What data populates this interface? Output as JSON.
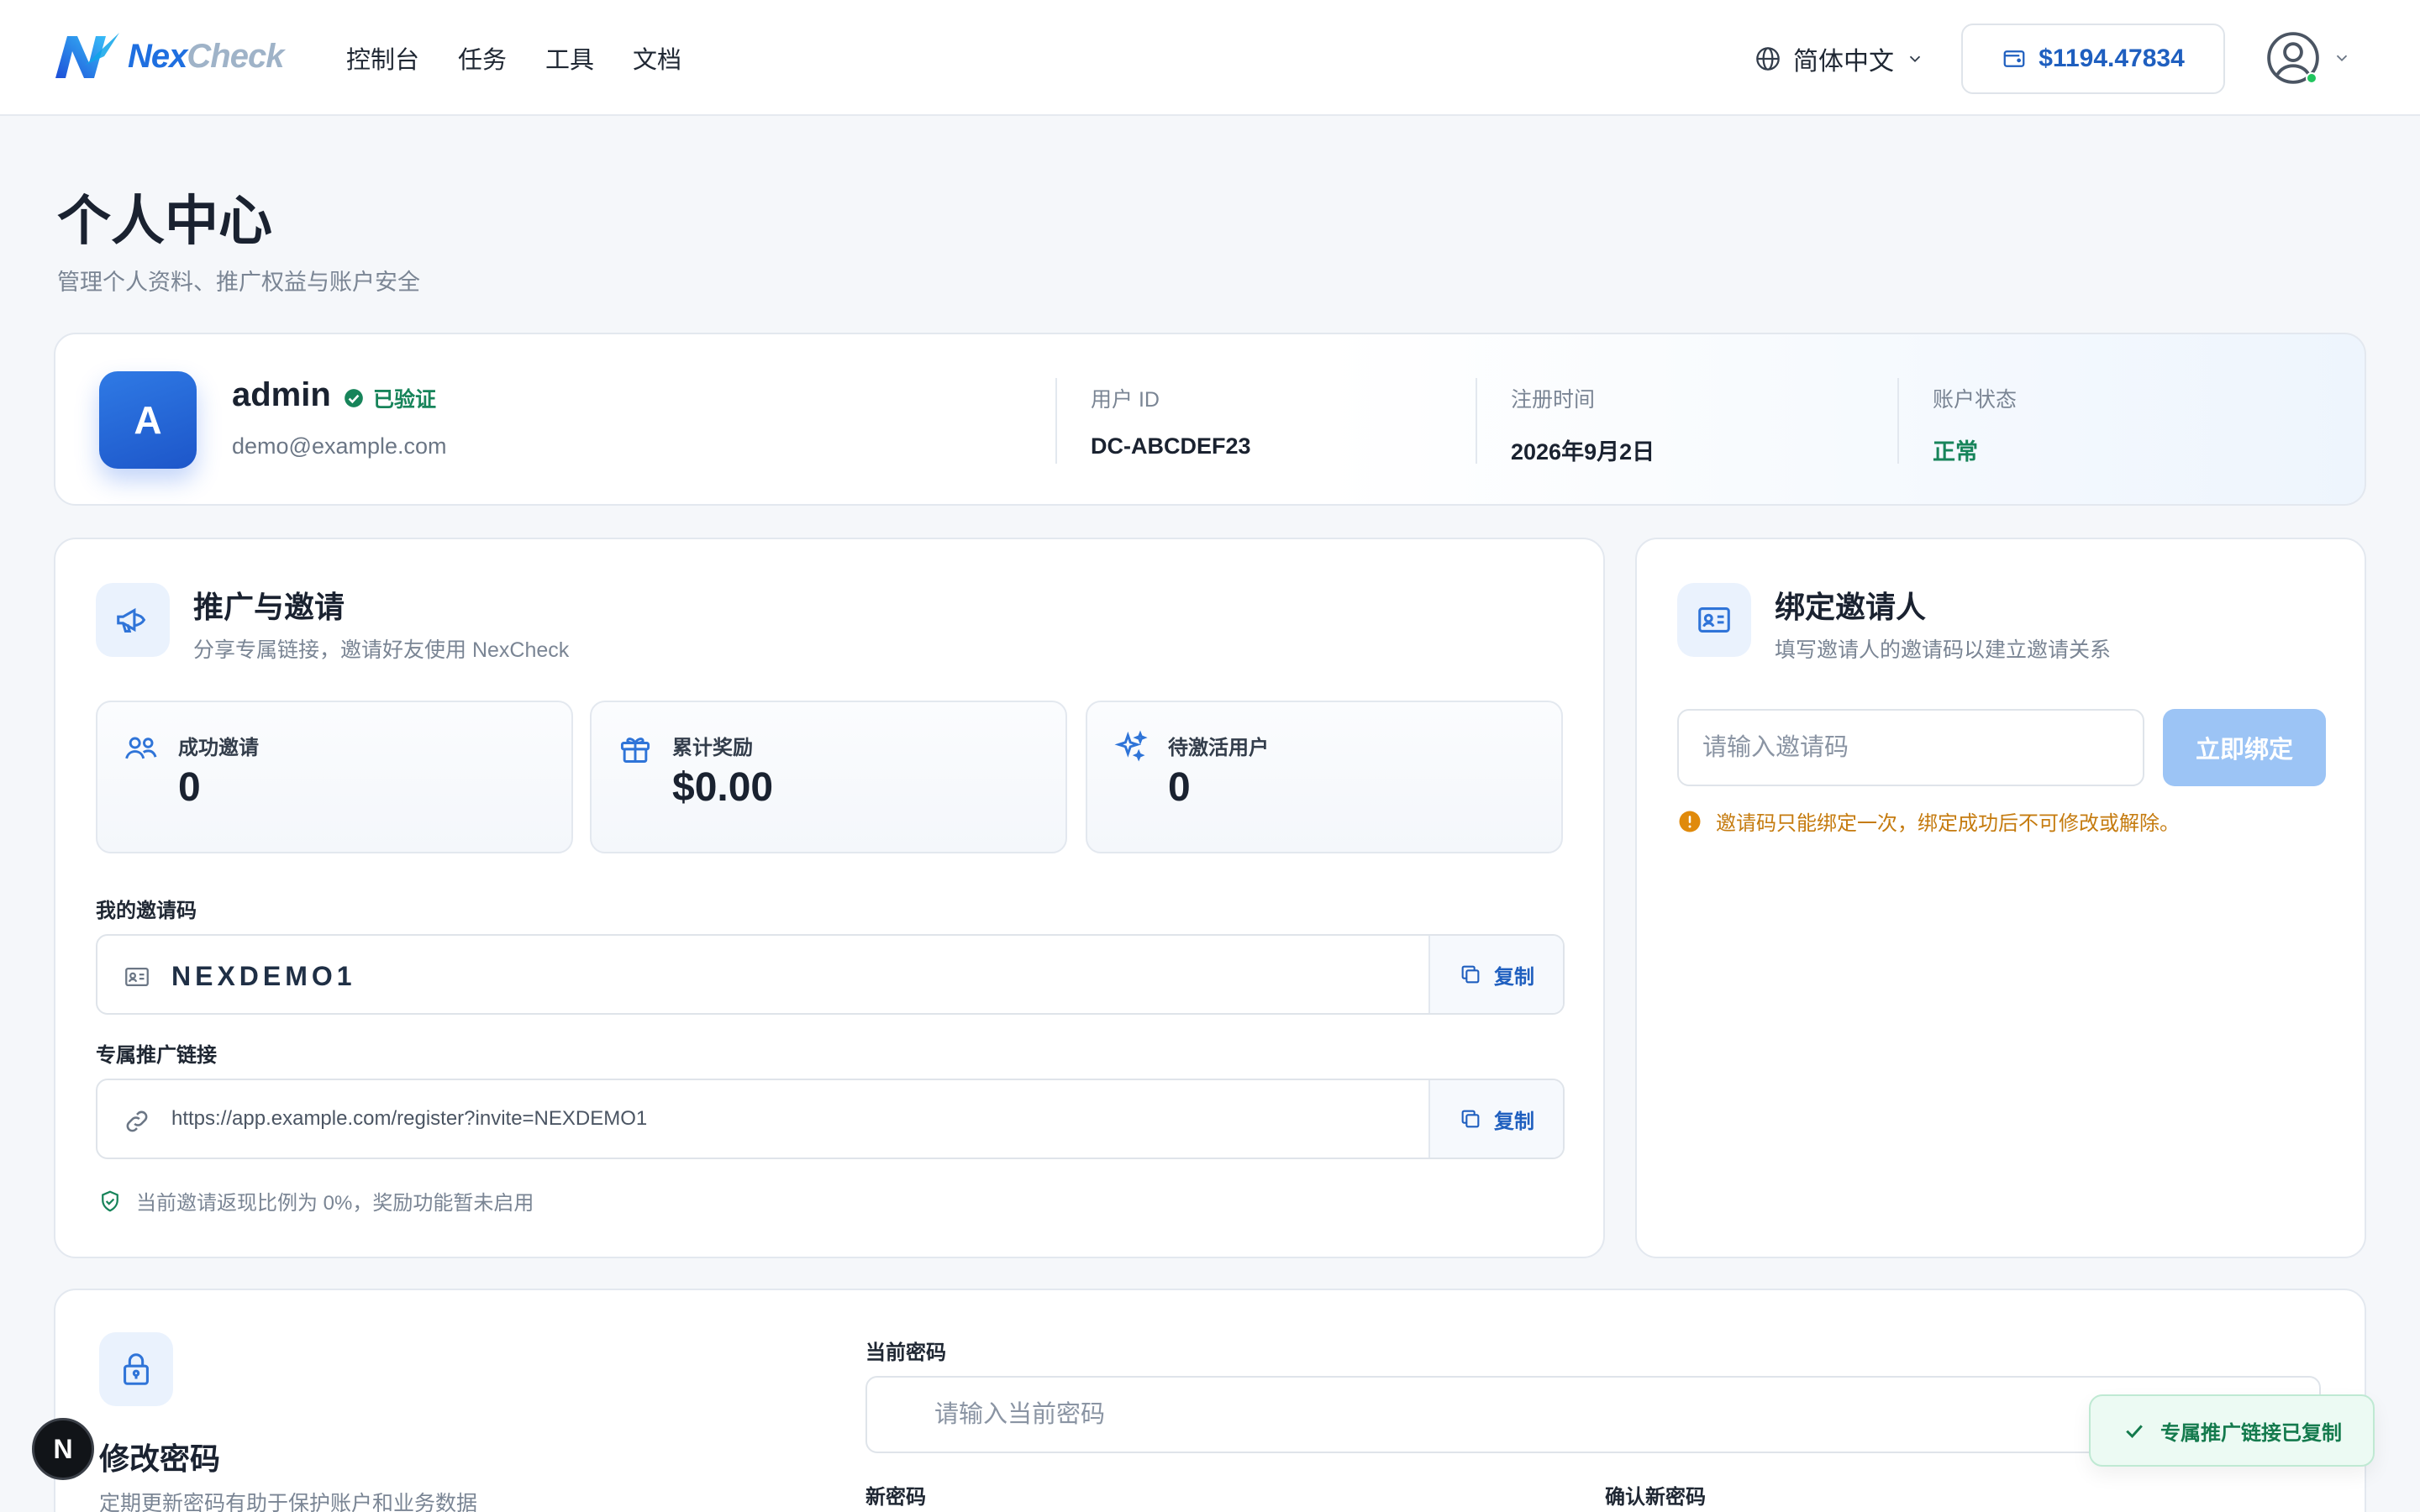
{
  "header": {
    "logo_text_a": "Nex",
    "logo_text_b": "Check",
    "nav": [
      "控制台",
      "任务",
      "工具",
      "文档"
    ],
    "language": "简体中文",
    "balance": "$1194.47834"
  },
  "page": {
    "title": "个人中心",
    "subtitle": "管理个人资料、推广权益与账户安全"
  },
  "profile": {
    "avatar_letter": "A",
    "username": "admin",
    "verified_label": "已验证",
    "email": "demo@example.com",
    "stats": [
      {
        "label": "用户 ID",
        "value": "DC-ABCDEF23"
      },
      {
        "label": "注册时间",
        "value": "2026年9月2日"
      },
      {
        "label": "账户状态",
        "value": "正常"
      }
    ]
  },
  "promo": {
    "title": "推广与邀请",
    "subtitle": "分享专属链接，邀请好友使用 NexCheck",
    "stats": [
      {
        "label": "成功邀请",
        "value": "0"
      },
      {
        "label": "累计奖励",
        "value": "$0.00"
      },
      {
        "label": "待激活用户",
        "value": "0"
      }
    ],
    "code_label": "我的邀请码",
    "code": "NEXDEMO1",
    "link_label": "专属推广链接",
    "link": "https://app.example.com/register?invite=NEXDEMO1",
    "copy_label": "复制",
    "note": "当前邀请返现比例为 0%，奖励功能暂未启用"
  },
  "bind": {
    "title": "绑定邀请人",
    "subtitle": "填写邀请人的邀请码以建立邀请关系",
    "input_placeholder": "请输入邀请码",
    "button_label": "立即绑定",
    "warning": "邀请码只能绑定一次，绑定成功后不可修改或解除。"
  },
  "password": {
    "title": "修改密码",
    "subtitle": "定期更新密码有助于保护账户和业务数据",
    "current_label": "当前密码",
    "current_placeholder": "请输入当前密码",
    "new_label": "新密码",
    "confirm_label": "确认新密码"
  },
  "toast": {
    "message": "专属推广链接已复制"
  },
  "dev_badge": "N",
  "colors": {
    "accent": "#1f5fbf",
    "success": "#17845a",
    "warning": "#c57b0f",
    "bind_button": "#9cc4f5"
  }
}
